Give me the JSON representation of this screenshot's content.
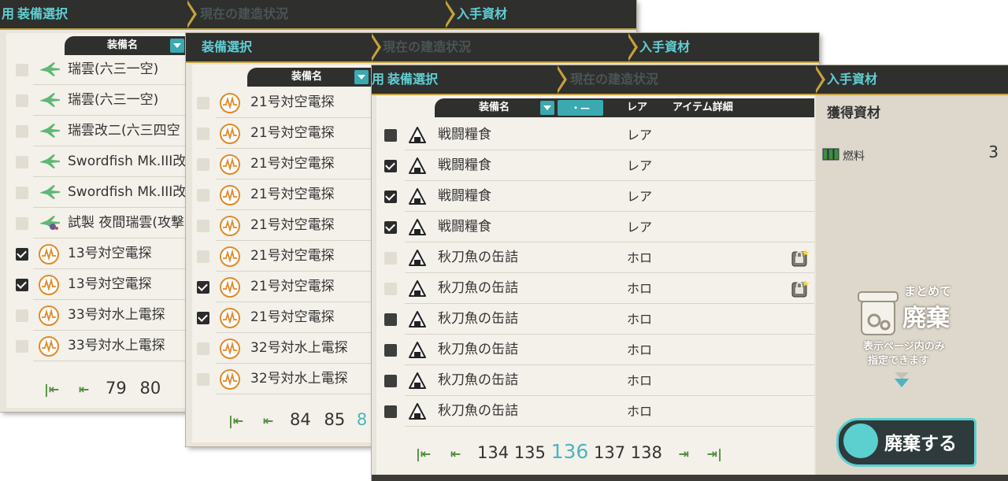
{
  "tabs": {
    "equip_select": "装備選択",
    "construction": "現在の建造状況",
    "resources": "入手資材"
  },
  "panel1": {
    "column_name": "装備名",
    "rows": [
      {
        "name": "瑞雲(六三一空)",
        "checked": "off",
        "icon": "seaplane-icon"
      },
      {
        "name": "瑞雲(六三一空)",
        "checked": "off",
        "icon": "seaplane-icon"
      },
      {
        "name": "瑞雲改二(六三四空",
        "checked": "off",
        "icon": "seaplane-icon"
      },
      {
        "name": "Swordfish Mk.III改",
        "checked": "off",
        "icon": "seaplane-icon"
      },
      {
        "name": "Swordfish Mk.III改",
        "checked": "off",
        "icon": "seaplane-icon"
      },
      {
        "name": "試製 夜間瑞雲(攻撃",
        "checked": "off",
        "icon": "night-seaplane-icon"
      },
      {
        "name": "13号対空電探",
        "checked": "on",
        "icon": "radar-icon"
      },
      {
        "name": "13号対空電探",
        "checked": "on",
        "icon": "radar-icon"
      },
      {
        "name": "33号対水上電探",
        "checked": "off",
        "icon": "radar-icon"
      },
      {
        "name": "33号対水上電探",
        "checked": "off",
        "icon": "radar-icon"
      }
    ],
    "pages": [
      "79",
      "80"
    ]
  },
  "panel2": {
    "column_name": "装備名",
    "rows": [
      {
        "name": "21号対空電探",
        "checked": "off"
      },
      {
        "name": "21号対空電探",
        "checked": "off"
      },
      {
        "name": "21号対空電探",
        "checked": "off"
      },
      {
        "name": "21号対空電探",
        "checked": "off"
      },
      {
        "name": "21号対空電探",
        "checked": "off"
      },
      {
        "name": "21号対空電探",
        "checked": "off"
      },
      {
        "name": "21号対空電探",
        "checked": "on"
      },
      {
        "name": "21号対空電探",
        "checked": "on"
      },
      {
        "name": "32号対水上電探",
        "checked": "off"
      },
      {
        "name": "32号対水上電探",
        "checked": "off"
      }
    ],
    "pages": [
      "84",
      "85",
      "8"
    ]
  },
  "panel3": {
    "column_name": "装備名",
    "filter_label": "・—",
    "column_rare": "レア",
    "column_detail": "アイテム詳細",
    "rows": [
      {
        "name": "戦闘糧食",
        "rare": "レア",
        "checked": "dark",
        "locked": false
      },
      {
        "name": "戦闘糧食",
        "rare": "レア",
        "checked": "on",
        "locked": false
      },
      {
        "name": "戦闘糧食",
        "rare": "レア",
        "checked": "on",
        "locked": false
      },
      {
        "name": "戦闘糧食",
        "rare": "レア",
        "checked": "on",
        "locked": false
      },
      {
        "name": "秋刀魚の缶詰",
        "rare": "ホロ",
        "checked": "off",
        "locked": true
      },
      {
        "name": "秋刀魚の缶詰",
        "rare": "ホロ",
        "checked": "off",
        "locked": true
      },
      {
        "name": "秋刀魚の缶詰",
        "rare": "ホロ",
        "checked": "dark",
        "locked": false
      },
      {
        "name": "秋刀魚の缶詰",
        "rare": "ホロ",
        "checked": "dark",
        "locked": false
      },
      {
        "name": "秋刀魚の缶詰",
        "rare": "ホロ",
        "checked": "dark",
        "locked": false
      },
      {
        "name": "秋刀魚の缶詰",
        "rare": "ホロ",
        "checked": "dark",
        "locked": false
      }
    ],
    "pages": [
      "134",
      "135",
      "136",
      "137",
      "138"
    ],
    "current_page": "136",
    "acquired_title": "獲得資材",
    "resource_name": "燃料",
    "resource_value": "3",
    "bulk_line1": "まとめて",
    "bulk_line2": "廃棄",
    "bulk_line3": "表示ページ内のみ",
    "bulk_line4": "指定できます",
    "scrap_button": "廃棄する"
  },
  "colors": {
    "accent": "#4ab5bf",
    "bar": "#2f2f2d",
    "gold": "#c2a23c",
    "panel": "#e9e5dd"
  }
}
